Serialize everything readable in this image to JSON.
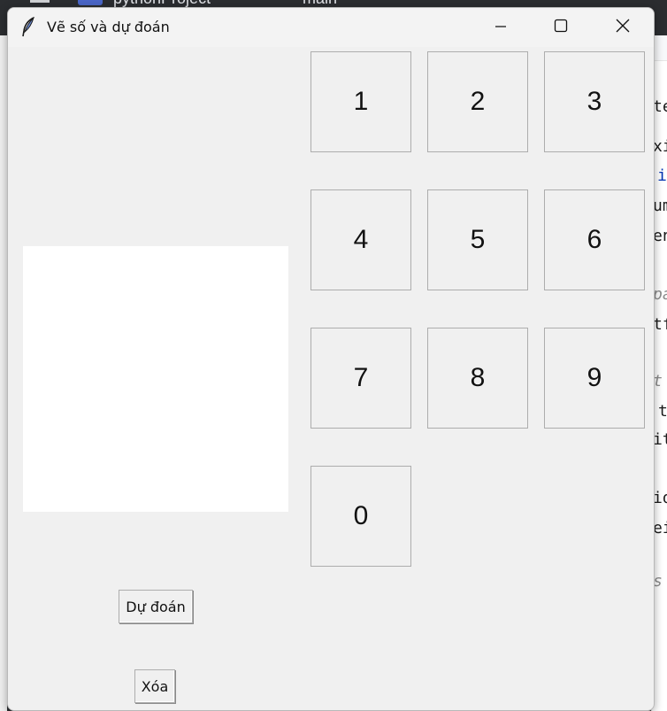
{
  "background": {
    "ide_project": "pythonProject",
    "ide_branch": "main",
    "editor_lines": [
      "te",
      "xi",
      "i",
      "um",
      "en",
      "pa",
      "tf",
      "t",
      "t",
      "it",
      "id",
      "ei",
      "s"
    ]
  },
  "window": {
    "title": "Vẽ số và dự đoán",
    "icon": "feather-icon",
    "controls": [
      "minimize-icon",
      "maximize-icon",
      "close-icon"
    ]
  },
  "digits": [
    "1",
    "2",
    "3",
    "4",
    "5",
    "6",
    "7",
    "8",
    "9",
    "0"
  ],
  "buttons": {
    "predict_label": "Dự đoán",
    "clear_label": "Xóa"
  },
  "colors": {
    "window_bg": "#f0f0f0",
    "canvas_bg": "#ffffff",
    "button_border": "#adadad"
  }
}
